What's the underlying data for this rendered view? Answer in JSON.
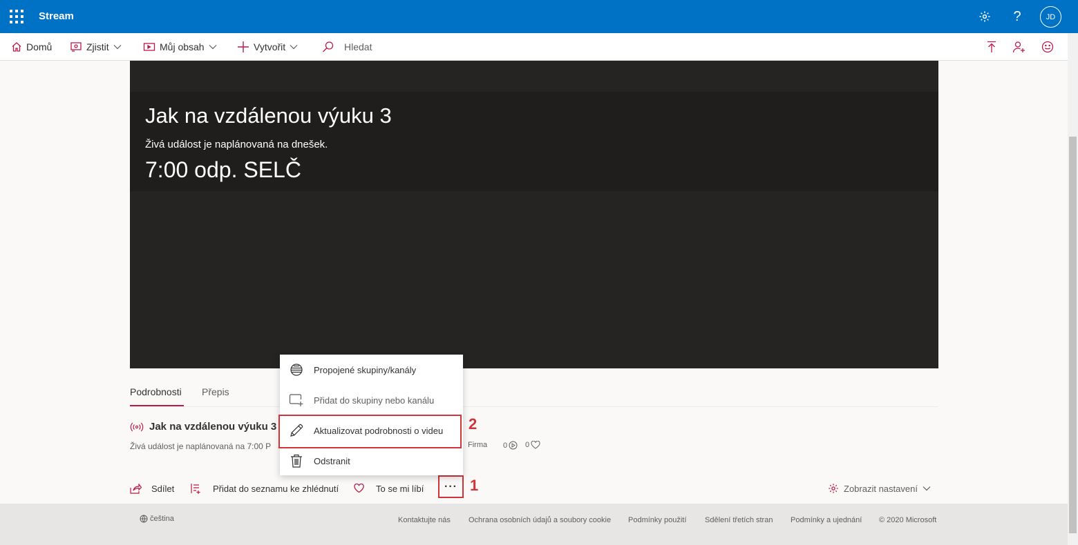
{
  "appbar": {
    "title": "Stream",
    "help_glyph": "?",
    "avatar_initials": "JD",
    "color": "#0072c6"
  },
  "nav": {
    "home_label": "Domů",
    "discover_label": "Zjistit",
    "my_content_label": "Můj obsah",
    "create_label": "Vytvořit",
    "search_label": "Hledat",
    "accent_color": "#bc1948"
  },
  "player": {
    "title": "Jak na vzdálenou výuku 3",
    "subtitle": "Živá událost je naplánovaná na dnešek.",
    "time": "7:00 odp. SELČ"
  },
  "tabs": {
    "details": "Podrobnosti",
    "transcript": "Přepis"
  },
  "details": {
    "title": "Jak na vzdálenou výuku 3",
    "subtitle": "Živá událost je naplánovaná na 7:00 P",
    "privacy": "Firma",
    "views": "0",
    "likes": "0"
  },
  "actions": {
    "share": "Sdílet",
    "add_watchlist": "Přidat do seznamu ke zhlédnutí",
    "like": "To se mi líbí",
    "more": "···",
    "settings": "Zobrazit nastavení"
  },
  "context_menu": {
    "items": [
      {
        "label": "Propojené skupiny/kanály",
        "icon": "globe-icon"
      },
      {
        "label": "Přidat do skupiny nebo kanálu",
        "icon": "add-to-group-icon"
      },
      {
        "label": "Aktualizovat podrobnosti o videu",
        "icon": "pencil-icon"
      },
      {
        "label": "Odstranit",
        "icon": "trash-icon"
      }
    ]
  },
  "callouts": {
    "step1": "1",
    "step2": "2",
    "color": "#d13438"
  },
  "footer": {
    "language": "čeština",
    "links": [
      "Kontaktujte nás",
      "Ochrana osobních údajů a soubory cookie",
      "Podmínky použití",
      "Sdělení třetích stran",
      "Podmínky a ujednání",
      "© 2020 Microsoft"
    ]
  }
}
